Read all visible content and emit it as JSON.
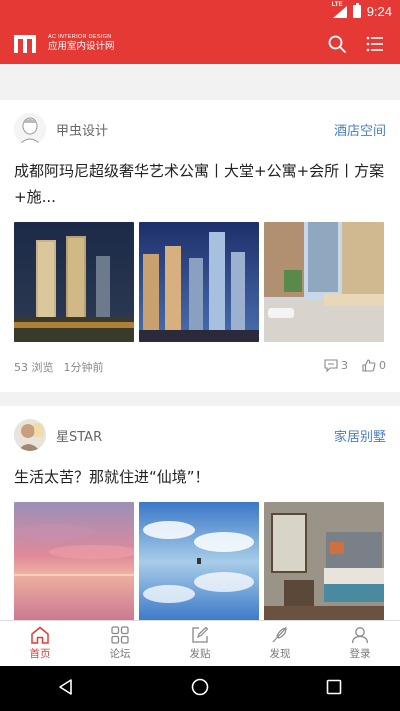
{
  "status_bar": {
    "time": "9:24",
    "network": "LTE"
  },
  "app_bar": {
    "logo_en": "AC INTERIOR DESIGN",
    "logo_cn": "应用室内设计网"
  },
  "feed": [
    {
      "author": "甲虫设计",
      "tag": "酒店空间",
      "title": "成都阿玛尼超级奢华艺术公寓丨大堂+公寓+会所丨方案+施...",
      "views": "53 浏览",
      "time": "1分钟前",
      "comments": "3",
      "likes": "0"
    },
    {
      "author": "星STAR",
      "tag": "家居别墅",
      "title": "生活太苦？那就住进“仙境”！"
    }
  ],
  "tabs": [
    {
      "label": "首页",
      "icon": "home-icon",
      "active": true
    },
    {
      "label": "论坛",
      "icon": "grid-icon"
    },
    {
      "label": "发贴",
      "icon": "edit-icon"
    },
    {
      "label": "发现",
      "icon": "feather-icon"
    },
    {
      "label": "登录",
      "icon": "user-icon"
    }
  ],
  "colors": {
    "brand": "#e53935",
    "tag": "#4a7fc1"
  }
}
